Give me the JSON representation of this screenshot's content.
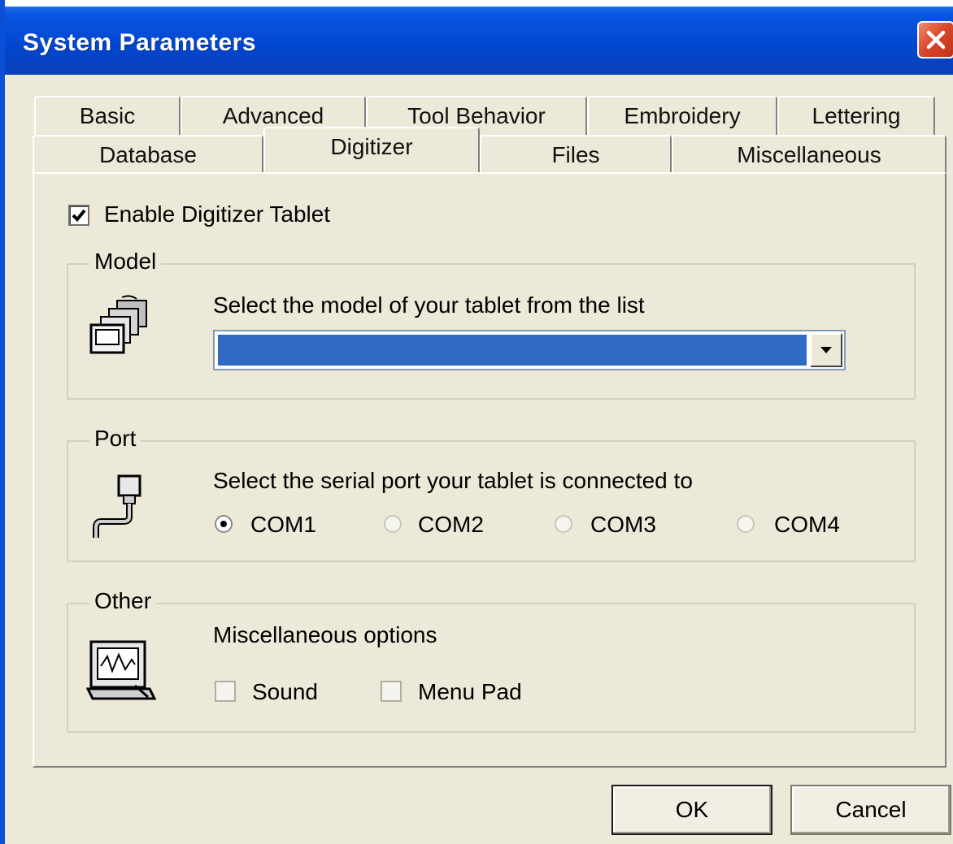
{
  "window": {
    "title": "System Parameters"
  },
  "tabs": {
    "back_row": [
      {
        "label": "Basic"
      },
      {
        "label": "Advanced"
      },
      {
        "label": "Tool Behavior"
      },
      {
        "label": "Embroidery"
      },
      {
        "label": "Lettering"
      }
    ],
    "front_row": [
      {
        "label": "Database"
      },
      {
        "label": "Digitizer",
        "active": true
      },
      {
        "label": "Files"
      },
      {
        "label": "Miscellaneous"
      }
    ]
  },
  "enable": {
    "label": "Enable Digitizer Tablet",
    "checked": true
  },
  "model": {
    "title": "Model",
    "prompt": "Select the model of your tablet from the list",
    "selected_value": ""
  },
  "port": {
    "title": "Port",
    "prompt": "Select the serial port your tablet is connected to",
    "options": [
      {
        "label": "COM1",
        "selected": true
      },
      {
        "label": "COM2",
        "selected": false
      },
      {
        "label": "COM3",
        "selected": false
      },
      {
        "label": "COM4",
        "selected": false
      }
    ]
  },
  "other": {
    "title": "Other",
    "prompt": "Miscellaneous options",
    "sound_label": "Sound",
    "menu_pad_label": "Menu Pad"
  },
  "buttons": {
    "ok": "OK",
    "cancel": "Cancel"
  },
  "icons": {
    "close": "close-icon",
    "model": "tablet-stack-icon",
    "port": "serial-cable-icon",
    "other": "monitor-waveform-icon"
  },
  "colors": {
    "title_bar": "#0047d0",
    "selection": "#316ac5",
    "close_button": "#d8452a",
    "dialog_bg": "#ece9d8"
  }
}
